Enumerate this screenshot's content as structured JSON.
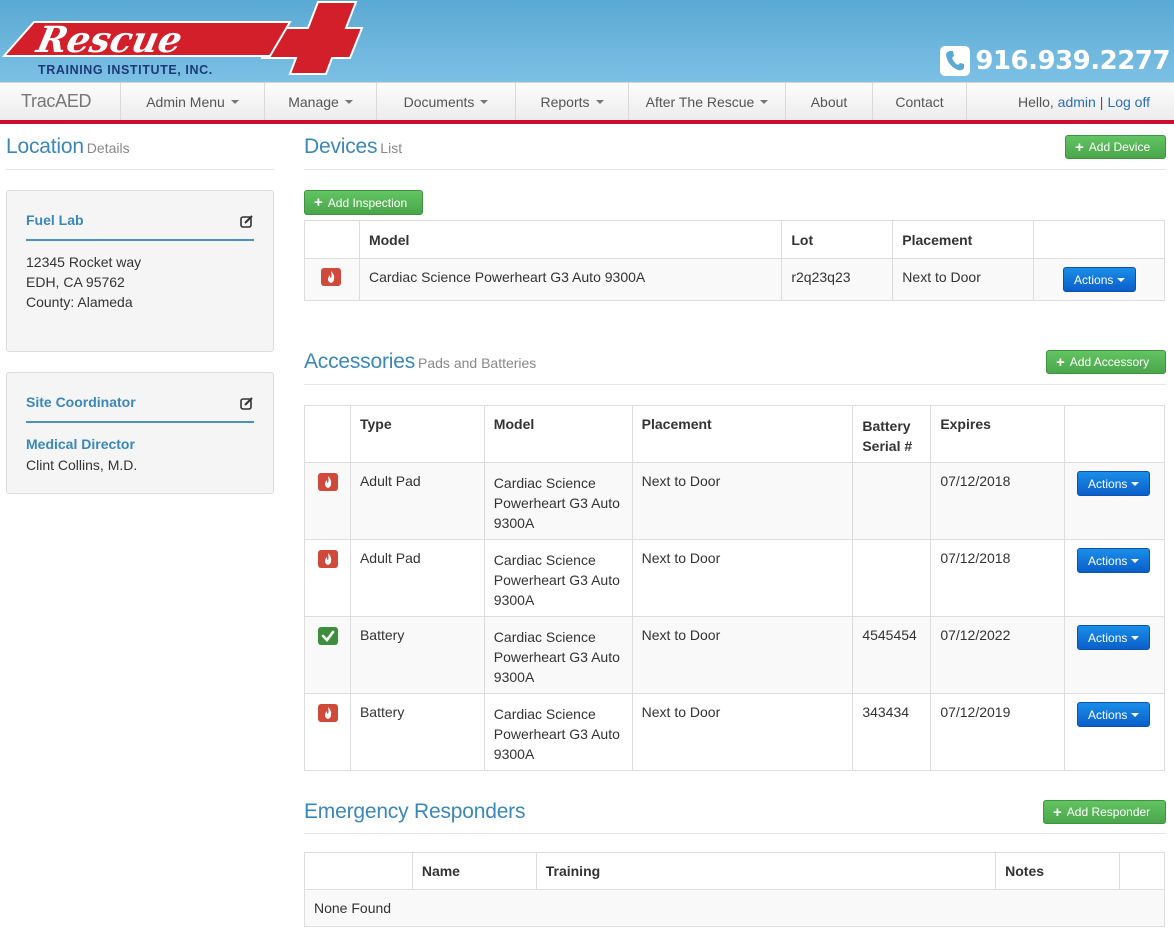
{
  "header": {
    "logo_text": "Rescue",
    "logo_subtext": "TRAINING INSTITUTE, INC.",
    "phone": "916.939.2277"
  },
  "nav": {
    "brand": "TracAED",
    "items": [
      {
        "label": "Admin Menu",
        "dropdown": true
      },
      {
        "label": "Manage",
        "dropdown": true
      },
      {
        "label": "Documents",
        "dropdown": true
      },
      {
        "label": "Reports",
        "dropdown": true
      },
      {
        "label": "After The Rescue",
        "dropdown": true
      },
      {
        "label": "About",
        "dropdown": false
      },
      {
        "label": "Contact",
        "dropdown": false
      }
    ],
    "hello": "Hello,",
    "user": "admin",
    "separator": "|",
    "logoff": "Log off"
  },
  "location": {
    "title": "Location",
    "subtitle": "Details",
    "name": "Fuel Lab",
    "address1": "12345 Rocket way",
    "address2": "EDH, CA 95762",
    "county": "County: Alameda",
    "site_coordinator_label": "Site Coordinator",
    "medical_director_label": "Medical Director",
    "medical_director": "Clint Collins, M.D."
  },
  "devices": {
    "title": "Devices",
    "subtitle": "List",
    "add_button": "Add Device",
    "add_inspection": "Add Inspection",
    "columns": [
      "",
      "Model",
      "Lot",
      "Placement",
      ""
    ],
    "rows": [
      {
        "status": "fire",
        "model": "Cardiac Science Powerheart G3 Auto 9300A",
        "lot": "r2q23q23",
        "placement": "Next to Door",
        "action": "Actions"
      }
    ]
  },
  "accessories": {
    "title": "Accessories",
    "subtitle": "Pads and Batteries",
    "add_button": "Add Accessory",
    "columns": [
      "",
      "Type",
      "Model",
      "Placement",
      "Battery Serial #",
      "Expires",
      ""
    ],
    "rows": [
      {
        "status": "fire",
        "type": "Adult Pad",
        "model": "Cardiac Science Powerheart G3 Auto 9300A",
        "placement": "Next to Door",
        "serial": "",
        "expires": "07/12/2018",
        "action": "Actions"
      },
      {
        "status": "fire",
        "type": "Adult Pad",
        "model": "Cardiac Science Powerheart G3 Auto 9300A",
        "placement": "Next to Door",
        "serial": "",
        "expires": "07/12/2018",
        "action": "Actions"
      },
      {
        "status": "check",
        "type": "Battery",
        "model": "Cardiac Science Powerheart G3 Auto 9300A",
        "placement": "Next to Door",
        "serial": "4545454",
        "expires": "07/12/2022",
        "action": "Actions"
      },
      {
        "status": "fire",
        "type": "Battery",
        "model": "Cardiac Science Powerheart G3 Auto 9300A",
        "placement": "Next to Door",
        "serial": "343434",
        "expires": "07/12/2019",
        "action": "Actions"
      }
    ]
  },
  "responders": {
    "title": "Emergency Responders",
    "add_button": "Add Responder",
    "columns": [
      "",
      "Name",
      "Training",
      "Notes",
      ""
    ],
    "empty": "None Found"
  },
  "colors": {
    "brand_red": "#c8102e",
    "heading_blue": "#3a87b8",
    "success_green": "#4aa64a",
    "primary_blue": "#0a5fc9",
    "danger_red": "#d04a3c"
  }
}
